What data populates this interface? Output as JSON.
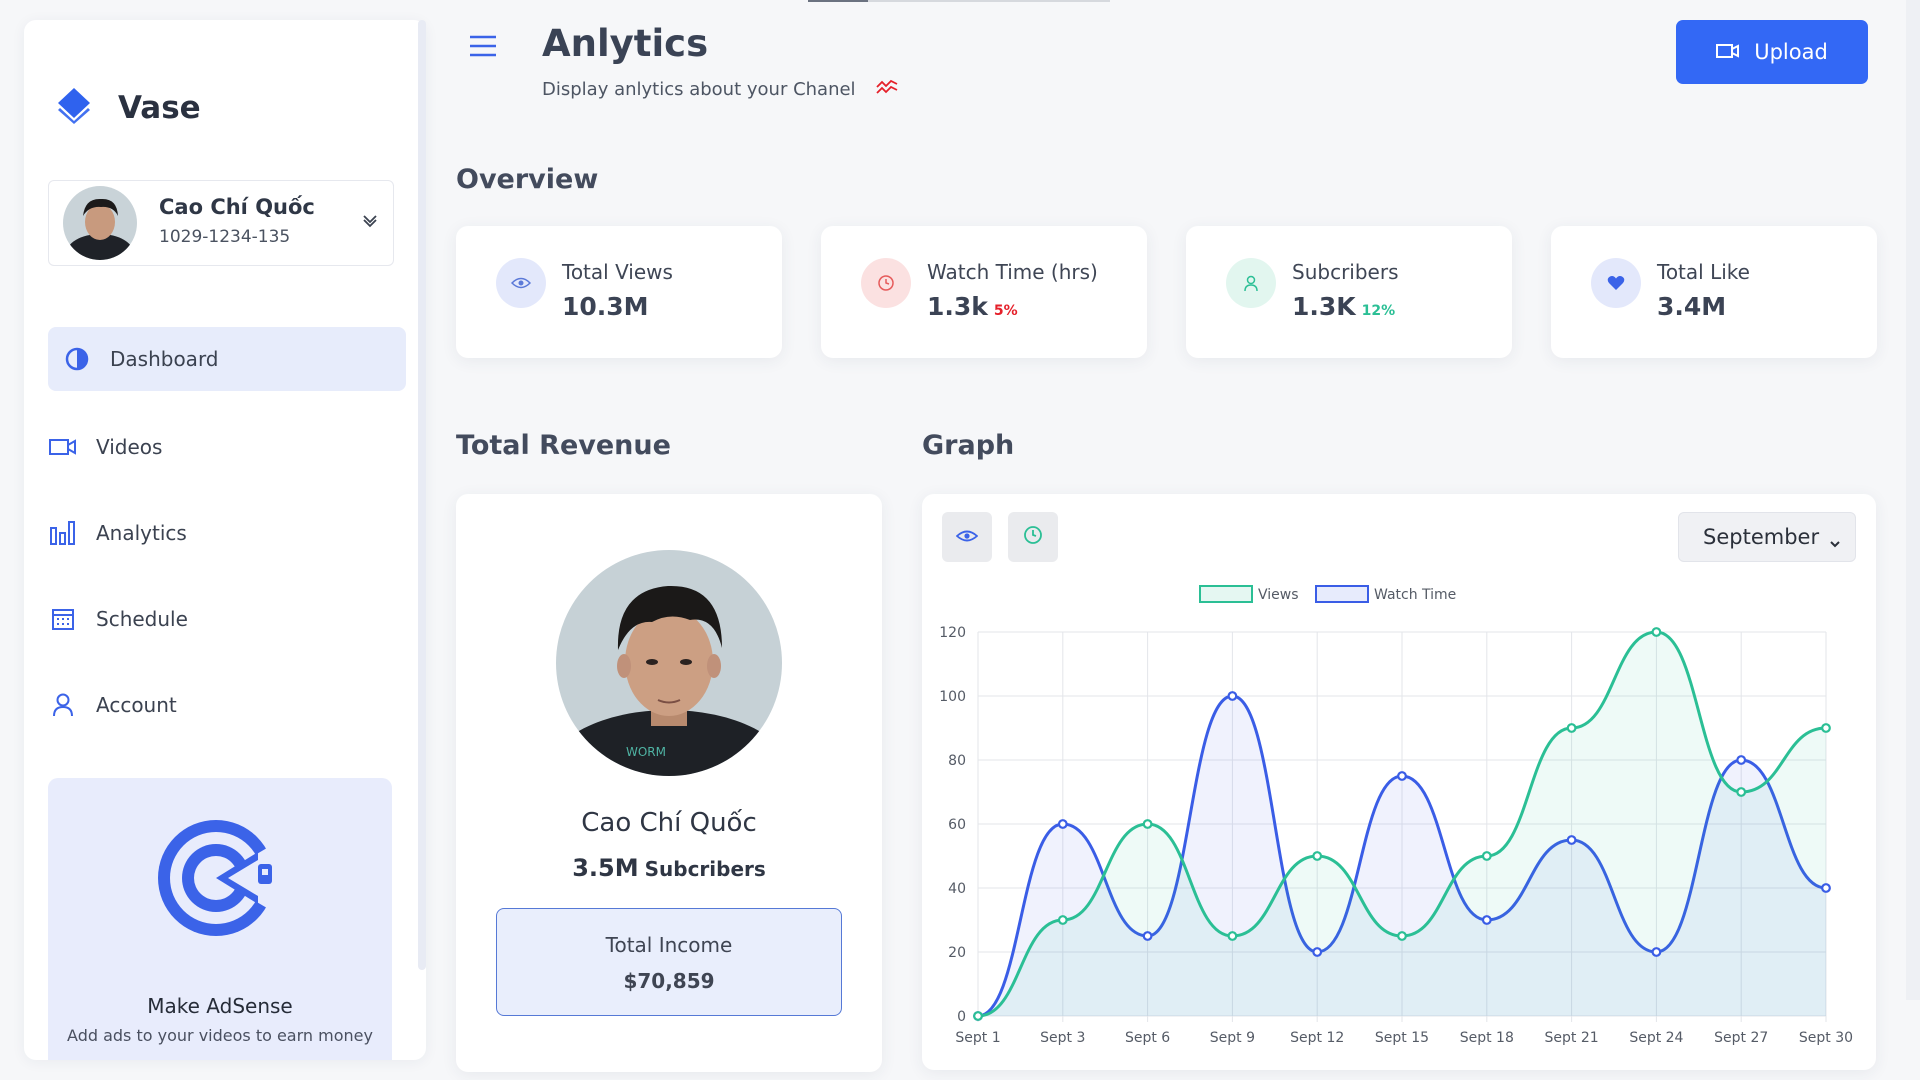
{
  "brand": {
    "name": "Vase"
  },
  "user": {
    "name": "Cao Chí Quốc",
    "id": "1029-1234-135"
  },
  "nav": [
    {
      "label": "Dashboard",
      "icon": "contrast-icon",
      "active": true
    },
    {
      "label": "Videos",
      "icon": "video-icon",
      "active": false
    },
    {
      "label": "Analytics",
      "icon": "bar-chart-icon",
      "active": false
    },
    {
      "label": "Schedule",
      "icon": "calendar-icon",
      "active": false
    },
    {
      "label": "Account",
      "icon": "user-icon",
      "active": false
    }
  ],
  "adsense": {
    "title": "Make AdSense",
    "subtitle": "Add ads to your videos to earn money"
  },
  "header": {
    "title": "Anlytics",
    "subtitle": "Display anlytics about your Chanel",
    "upload_label": "Upload"
  },
  "overview": {
    "heading": "Overview",
    "stats": [
      {
        "label": "Total Views",
        "value": "10.3M",
        "pct": "",
        "icon": "eye-icon",
        "icon_bg": "#e3e8fb",
        "icon_color": "#5b79d8"
      },
      {
        "label": "Watch Time (hrs)",
        "value": "1.3k",
        "pct": "5%",
        "pct_color": "#e5202a",
        "icon": "clock-icon",
        "icon_bg": "#fbe1e1",
        "icon_color": "#e65a5a"
      },
      {
        "label": "Subcribers",
        "value": "1.3K",
        "pct": "12%",
        "pct_color": "#2bbf95",
        "icon": "user-icon",
        "icon_bg": "#e2f6ef",
        "icon_color": "#2bbf95"
      },
      {
        "label": "Total Like",
        "value": "3.4M",
        "pct": "",
        "icon": "heart-icon",
        "icon_bg": "#e3e8fb",
        "icon_color": "#3b63e8"
      }
    ]
  },
  "revenue": {
    "heading": "Total Revenue",
    "name": "Cao Chí Quốc",
    "subs_value": "3.5M",
    "subs_label": "Subcribers",
    "income_label": "Total Income",
    "income_value": "$70,859"
  },
  "graph": {
    "heading": "Graph",
    "month": "September"
  },
  "colors": {
    "accent": "#3368f5",
    "views": "#2bbf95",
    "watch": "#3a5de6",
    "watch_light": "#b3c4f2"
  },
  "chart_data": {
    "type": "line",
    "categories": [
      "Sept 1",
      "Sept 3",
      "Sept 6",
      "Sept 9",
      "Sept 12",
      "Sept 15",
      "Sept 18",
      "Sept 21",
      "Sept 24",
      "Sept 27",
      "Sept 30"
    ],
    "series": [
      {
        "name": "Views",
        "values": [
          0,
          30,
          60,
          25,
          50,
          25,
          50,
          90,
          120,
          70,
          90
        ]
      },
      {
        "name": "Watch Time",
        "values": [
          0,
          60,
          25,
          100,
          20,
          75,
          30,
          55,
          20,
          80,
          40
        ]
      }
    ],
    "ylim": [
      0,
      120
    ],
    "yticks": [
      0,
      20,
      40,
      60,
      80,
      100,
      120
    ],
    "grid": true,
    "legend": "top-center"
  }
}
